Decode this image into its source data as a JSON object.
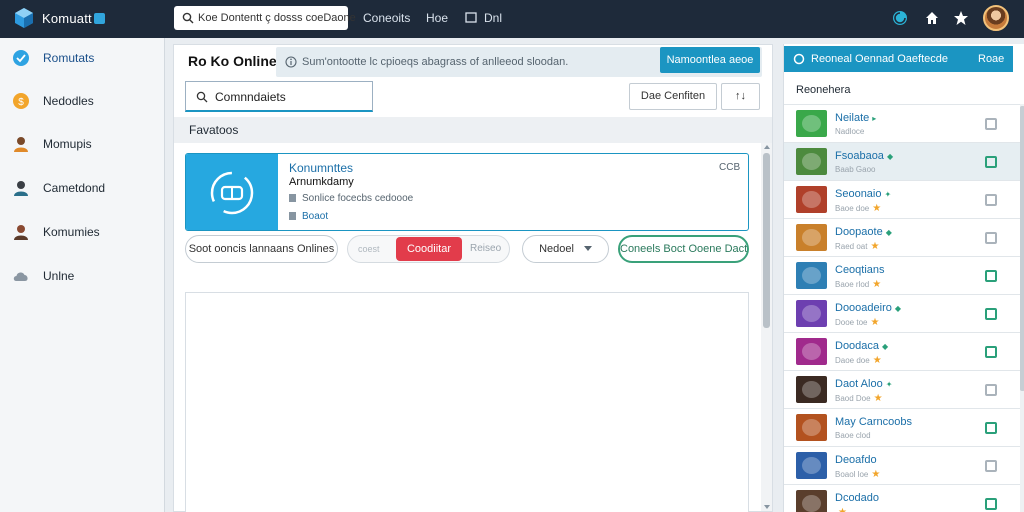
{
  "app": {
    "brand": "Komuatt",
    "search_text": "Koe Dontentt ç dosss coeDaone"
  },
  "topnav": {
    "links": [
      "Coneoits",
      "Hoe",
      "Dnl"
    ]
  },
  "icons": {
    "logo": "cube-logo-icon",
    "search": "search-icon",
    "refresh": "refresh-icon",
    "home": "home-icon",
    "star": "star-icon"
  },
  "colors": {
    "topbar": "#1e2a3a",
    "accent": "#1b95c2",
    "danger": "#e23c4b",
    "success": "#3aa17a"
  },
  "sidebar": {
    "items": [
      {
        "label": "Romutats",
        "icon": "check-badge-icon",
        "color": "#2ea3e2"
      },
      {
        "label": "Nedodles",
        "icon": "coin-icon",
        "color": "#f2a52b"
      },
      {
        "label": "Momupis",
        "icon": "person-icon",
        "color": "#7a4a2a"
      },
      {
        "label": "Cametdond",
        "icon": "person-icon",
        "color": "#3a3f45"
      },
      {
        "label": "Komumies",
        "icon": "person-icon",
        "color": "#8a4a32"
      },
      {
        "label": "Unlne",
        "icon": "cloud-icon",
        "color": "#8a96a2"
      }
    ]
  },
  "main": {
    "title": "Ro Ko Online",
    "notice": "Sum'ontootte lc cpioeqs abagrass of anlleeod sloodan.",
    "notice_button": "Namoontlea aeoe",
    "search_value": "Comnndaiets",
    "confirm_button": "Dae Cenfiten",
    "sort_button": "↑↓",
    "section_label": "Favatoos",
    "card": {
      "title": "Konumnttes",
      "subtitle": "Arnumkdamy",
      "meta1": "Sonlice focecbs cedoooe",
      "meta2": "Boaot",
      "code": "CCB"
    },
    "filters": {
      "pill_left": "Soot ooncis lannaans Onlines",
      "seg_left": "coest",
      "seg_active": "Coodiitar",
      "seg_right": "Reiseo",
      "select_value": "Nedoel",
      "green_button": "Coneels Boct Ooene Dact"
    }
  },
  "right": {
    "header": "Reoneal Oennad Oaeftecde",
    "header_button": "Roae",
    "subheader": "Reonehera",
    "rows": [
      {
        "title": "Neilate",
        "sub": "Nadloce",
        "stars": "",
        "mark": "▸",
        "thumb": "#3aa84a",
        "check": "#aab3bb"
      },
      {
        "title": "Fsoabaoa",
        "sub": "Baab Gaoo",
        "stars": "",
        "mark": "◆",
        "thumb": "#4d8a3e",
        "check": "#2aa07a"
      },
      {
        "title": "Seoonaio",
        "sub": "Baoe doe",
        "stars": "★",
        "mark": "✦",
        "thumb": "#b0402a",
        "check": "#aab3bb"
      },
      {
        "title": "Doopaote",
        "sub": "Raed oat",
        "stars": "★",
        "mark": "◆",
        "thumb": "#c9802b",
        "check": "#aab3bb"
      },
      {
        "title": "Ceoqtians",
        "sub": "Baoe rlod",
        "stars": "★",
        "mark": "",
        "thumb": "#2e7fb4",
        "check": "#2aa07a"
      },
      {
        "title": "Doooadeiro",
        "sub": "Dooe toe",
        "stars": "★",
        "mark": "◆",
        "thumb": "#6d3fb0",
        "check": "#2aa07a"
      },
      {
        "title": "Doodaca",
        "sub": "Daoe doe",
        "stars": "★",
        "mark": "◆",
        "thumb": "#a02a8c",
        "check": "#2aa07a"
      },
      {
        "title": "Daot Aloo",
        "sub": "Baod Doe",
        "stars": "★",
        "mark": "✦",
        "thumb": "#3b2a22",
        "check": "#aab3bb"
      },
      {
        "title": "May Carncoobs",
        "sub": "Baoe clod",
        "stars": "",
        "mark": "",
        "thumb": "#b3521f",
        "check": "#2aa07a"
      },
      {
        "title": "Deoafdo",
        "sub": "Boaol loe",
        "stars": "★",
        "mark": "",
        "thumb": "#2c5fa8",
        "check": "#aab3bb"
      },
      {
        "title": "Dcodado",
        "sub": "",
        "stars": "★",
        "mark": "",
        "thumb": "#5a3e2c",
        "check": "#2aa07a"
      }
    ]
  }
}
